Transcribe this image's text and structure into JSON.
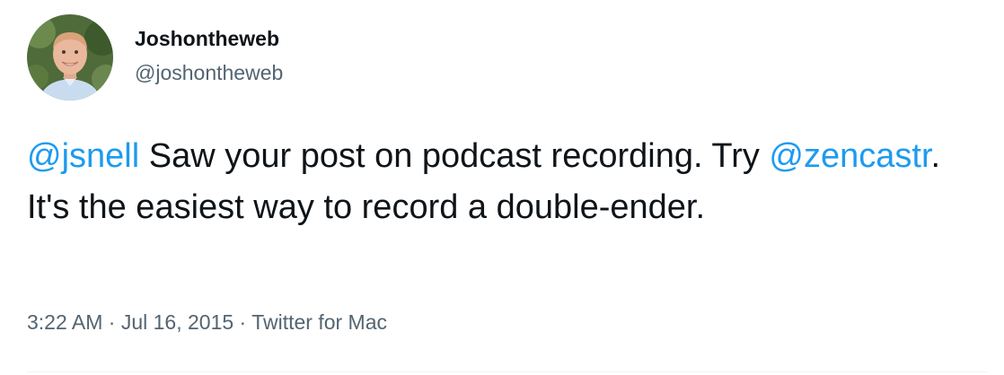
{
  "author": {
    "display_name": "Joshontheweb",
    "handle": "@joshontheweb",
    "avatar_icon": "profile-photo"
  },
  "tweet": {
    "mention_1": "@jsnell",
    "text_1": " Saw your post on podcast recording.  Try ",
    "mention_2": "@zencastr",
    "text_2": ".  It's the easiest way to record a double-ender."
  },
  "meta": {
    "time": "3:22 AM",
    "separator": " · ",
    "date": "Jul 16, 2015",
    "source": "Twitter for Mac"
  },
  "colors": {
    "text": "#0f1419",
    "secondary": "#536471",
    "link": "#1d9bf0",
    "divider": "#eff3f4"
  }
}
